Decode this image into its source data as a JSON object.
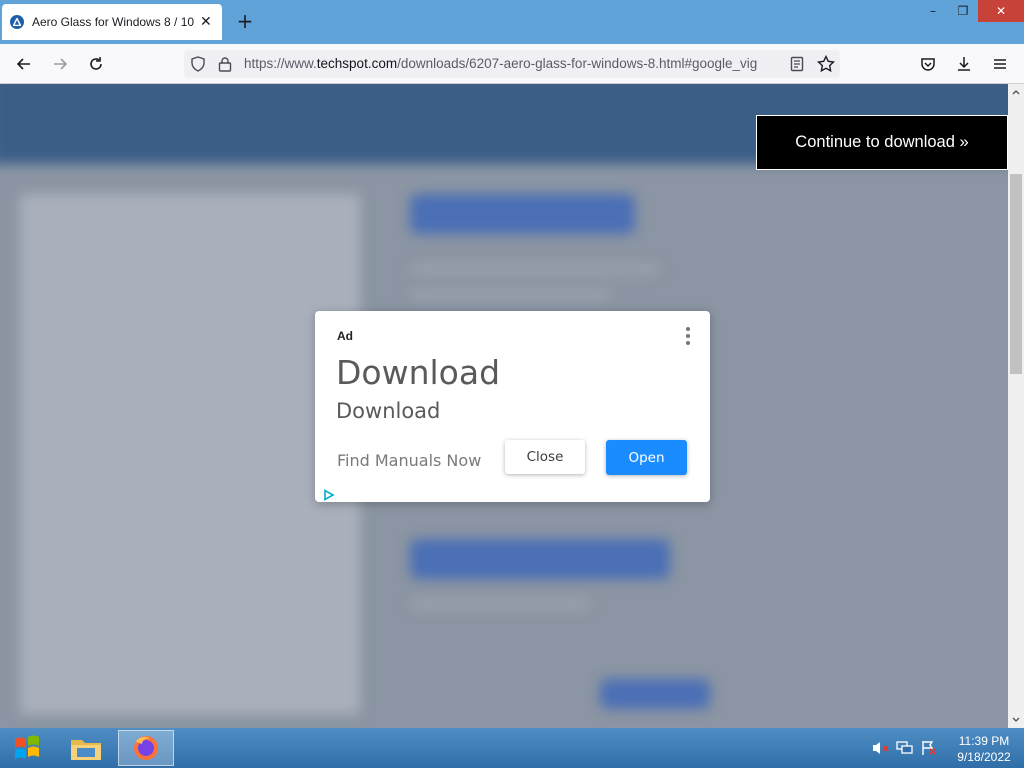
{
  "browser": {
    "tab": {
      "title": "Aero Glass for Windows 8 / 10 |",
      "close_glyph": "✕"
    },
    "new_tab_glyph": "+",
    "window_controls": {
      "minimize": "–",
      "restore": "❐",
      "close": "✕"
    },
    "url": {
      "prefix": "https://www.",
      "domain": "techspot.com",
      "path": "/downloads/6207-aero-glass-for-windows-8.html#google_vig"
    },
    "icons": {
      "back": "back-arrow-icon",
      "forward": "forward-arrow-icon",
      "reload": "reload-icon",
      "shield": "tracking-protection-shield-icon",
      "lock": "lock-icon",
      "reader": "reader-view-icon",
      "bookmark": "bookmark-star-icon",
      "pocket": "pocket-icon",
      "downloads": "downloads-icon",
      "menu": "hamburger-menu-icon"
    }
  },
  "page": {
    "continue_button": "Continue to download »"
  },
  "ad": {
    "label": "Ad",
    "headline": "Download",
    "subheadline": "Download",
    "description": "Find Manuals Now",
    "close_label": "Close",
    "open_label": "Open",
    "open_color": "#1a8cff"
  },
  "taskbar": {
    "time": "11:39 PM",
    "date": "9/18/2022",
    "items": [
      "start-orb-icon",
      "file-explorer-icon",
      "firefox-icon"
    ],
    "tray": [
      "volume-muted-icon",
      "network-icon",
      "action-center-flag-icon"
    ]
  },
  "colors": {
    "tabstrip": "#5fa3d9",
    "taskbar": "#2f6ea8",
    "overlay": "#8b95a3"
  }
}
